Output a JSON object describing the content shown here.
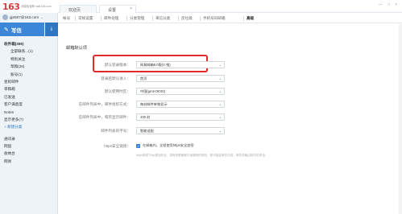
{
  "header": {
    "logo_number": "163",
    "logo_sub": "网易免费邮\nmail.163.com",
    "tabs": [
      {
        "label": "欢迎页"
      },
      {
        "label": "设置"
      }
    ],
    "tab_close": "×",
    "window_controls": [
      "—",
      "□",
      "×"
    ]
  },
  "sidebar": {
    "account": "gjn507@163.com",
    "compose_label": "写信",
    "compose_dropdown": "⌄",
    "items": [
      {
        "label": "收件箱(386)",
        "style": "bold"
      },
      {
        "label": "全部联系...(1)",
        "style": "sub"
      },
      {
        "label": "特别关注",
        "style": "sub"
      },
      {
        "label": "草稿(28)",
        "style": "sub"
      },
      {
        "label": "账号(1)",
        "style": "sub"
      },
      {
        "label": "星标邮件",
        "style": ""
      },
      {
        "label": "草稿箱",
        "style": ""
      },
      {
        "label": "已发送",
        "style": ""
      },
      {
        "label": "客户满意度",
        "style": ""
      },
      {
        "label": "Notes",
        "style": ""
      },
      {
        "label": "显示更多(7)",
        "style": ""
      },
      {
        "label": "+ 新建分类",
        "style": "blue"
      },
      {
        "label": "",
        "style": "sep"
      },
      {
        "label": "通讯录",
        "style": ""
      },
      {
        "label": "网盘",
        "style": ""
      },
      {
        "label": "收纳台",
        "style": ""
      },
      {
        "label": "网易",
        "style": ""
      }
    ]
  },
  "settings_nav": {
    "items": [
      "帐号",
      "常规设置",
      "邮件处理",
      "分类管理",
      "来信分类",
      "反垃圾",
      "手机号码邮箱",
      "高级"
    ],
    "active_index": 7
  },
  "section_title": "邮箱默认项",
  "rows": [
    {
      "label": "默认登录版本：",
      "value": "网易邮箱6.0版(V 推)"
    },
    {
      "label": "登录后默认进入：",
      "value": "首页"
    },
    {
      "label": "默认使用时区：",
      "value": "中国(gmt+08:00)"
    },
    {
      "label": "在邮件列表中，邮件组织方式：",
      "value": "每封邮件单独显示"
    },
    {
      "label": "在邮件列表中，每页显示邮件：",
      "value": "100 封"
    },
    {
      "label": "邮件列表的字号：",
      "value": "智能适配"
    }
  ],
  "https": {
    "label": "https安全链接：",
    "checkbox_label": "在邮箱内，全程使用https安全加密",
    "note": "https网络下tcp更加安全，将有效屏蔽被中途篡改的风险，即可保证邮件内容，邮件传输过程中的安全。"
  },
  "colors": {
    "accent": "#3b86d6",
    "highlight": "#e02a2a"
  }
}
